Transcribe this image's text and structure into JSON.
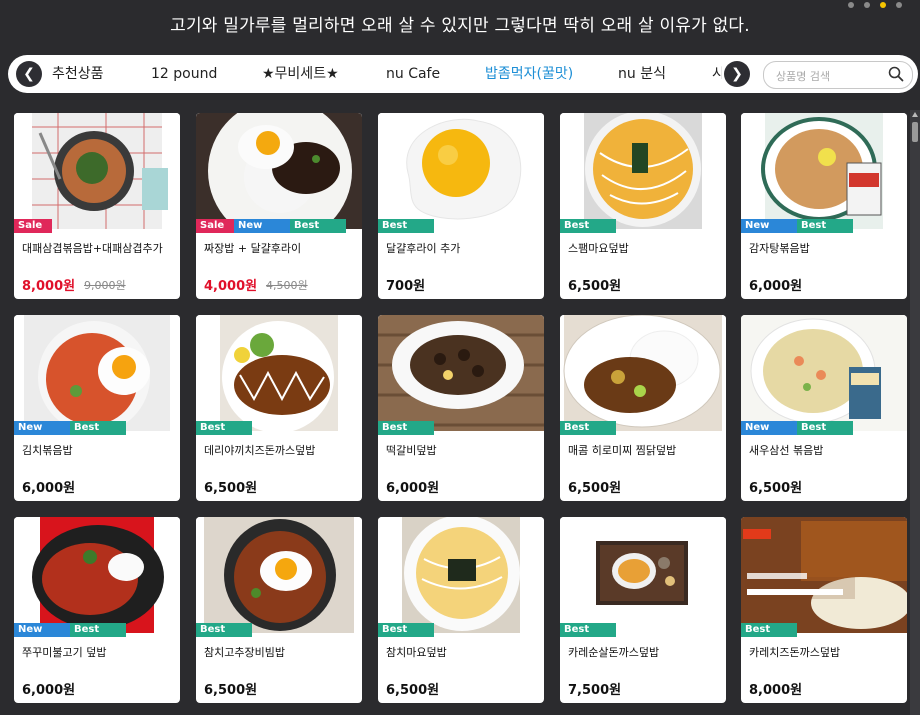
{
  "banner": {
    "text": "고기와 밀가루를 멀리하면 오래 살 수 있지만 그렇다면 딱히 오래 살 이유가 없다."
  },
  "nav": {
    "tabs": [
      {
        "label": "추천상품",
        "active": false
      },
      {
        "label": "12 pound",
        "active": false
      },
      {
        "label": "★무비세트★",
        "active": false
      },
      {
        "label": "nu Cafe",
        "active": false
      },
      {
        "label": "밥좀먹자(꿀맛)",
        "active": true
      },
      {
        "label": "nu 분식",
        "active": false
      },
      {
        "label": "시",
        "active": false
      }
    ],
    "prev_icon": "chevron-left-icon",
    "next_icon": "chevron-right-icon"
  },
  "search": {
    "placeholder": "상품명 검색",
    "value": "",
    "icon": "search-icon"
  },
  "colors": {
    "sale": "#e0285a",
    "new": "#2b87d8",
    "best": "#23a888",
    "active_tab": "#1e8fd6",
    "sale_price": "#e0102a"
  },
  "products": [
    {
      "name": "대패삼겹볶음밥+대패삼겹추가",
      "price": "8,000원",
      "old_price": "9,000원",
      "badges": [
        "Sale"
      ]
    },
    {
      "name": "짜장밥 + 달걀후라이",
      "price": "4,000원",
      "old_price": "4,500원",
      "badges": [
        "Sale",
        "New",
        "Best"
      ]
    },
    {
      "name": "달걀후라이 추가",
      "price": "700원",
      "old_price": "",
      "badges": [
        "Best"
      ]
    },
    {
      "name": "스팸마요덮밥",
      "price": "6,500원",
      "old_price": "",
      "badges": [
        "Best"
      ]
    },
    {
      "name": "감자탕볶음밥",
      "price": "6,000원",
      "old_price": "",
      "badges": [
        "New",
        "Best"
      ]
    },
    {
      "name": "김치볶음밥",
      "price": "6,000원",
      "old_price": "",
      "badges": [
        "New",
        "Best"
      ]
    },
    {
      "name": "데리야끼치즈돈까스덮밥",
      "price": "6,500원",
      "old_price": "",
      "badges": [
        "Best"
      ]
    },
    {
      "name": "떡갈비덮밥",
      "price": "6,000원",
      "old_price": "",
      "badges": [
        "Best"
      ]
    },
    {
      "name": "매콤 히로미찌 찜닭덮밥",
      "price": "6,500원",
      "old_price": "",
      "badges": [
        "Best"
      ]
    },
    {
      "name": "새우삼선 볶음밥",
      "price": "6,500원",
      "old_price": "",
      "badges": [
        "New",
        "Best"
      ]
    },
    {
      "name": "쭈꾸미불고기 덮밥",
      "price": "6,000원",
      "old_price": "",
      "badges": [
        "New",
        "Best"
      ]
    },
    {
      "name": "참치고추장비빔밥",
      "price": "6,500원",
      "old_price": "",
      "badges": [
        "Best"
      ]
    },
    {
      "name": "참치마요덮밥",
      "price": "6,500원",
      "old_price": "",
      "badges": [
        "Best"
      ]
    },
    {
      "name": "카레순살돈까스덮밥",
      "price": "7,500원",
      "old_price": "",
      "badges": [
        "Best"
      ]
    },
    {
      "name": "카레치즈돈까스덮밥",
      "price": "8,000원",
      "old_price": "",
      "badges": [
        "Best"
      ]
    }
  ]
}
